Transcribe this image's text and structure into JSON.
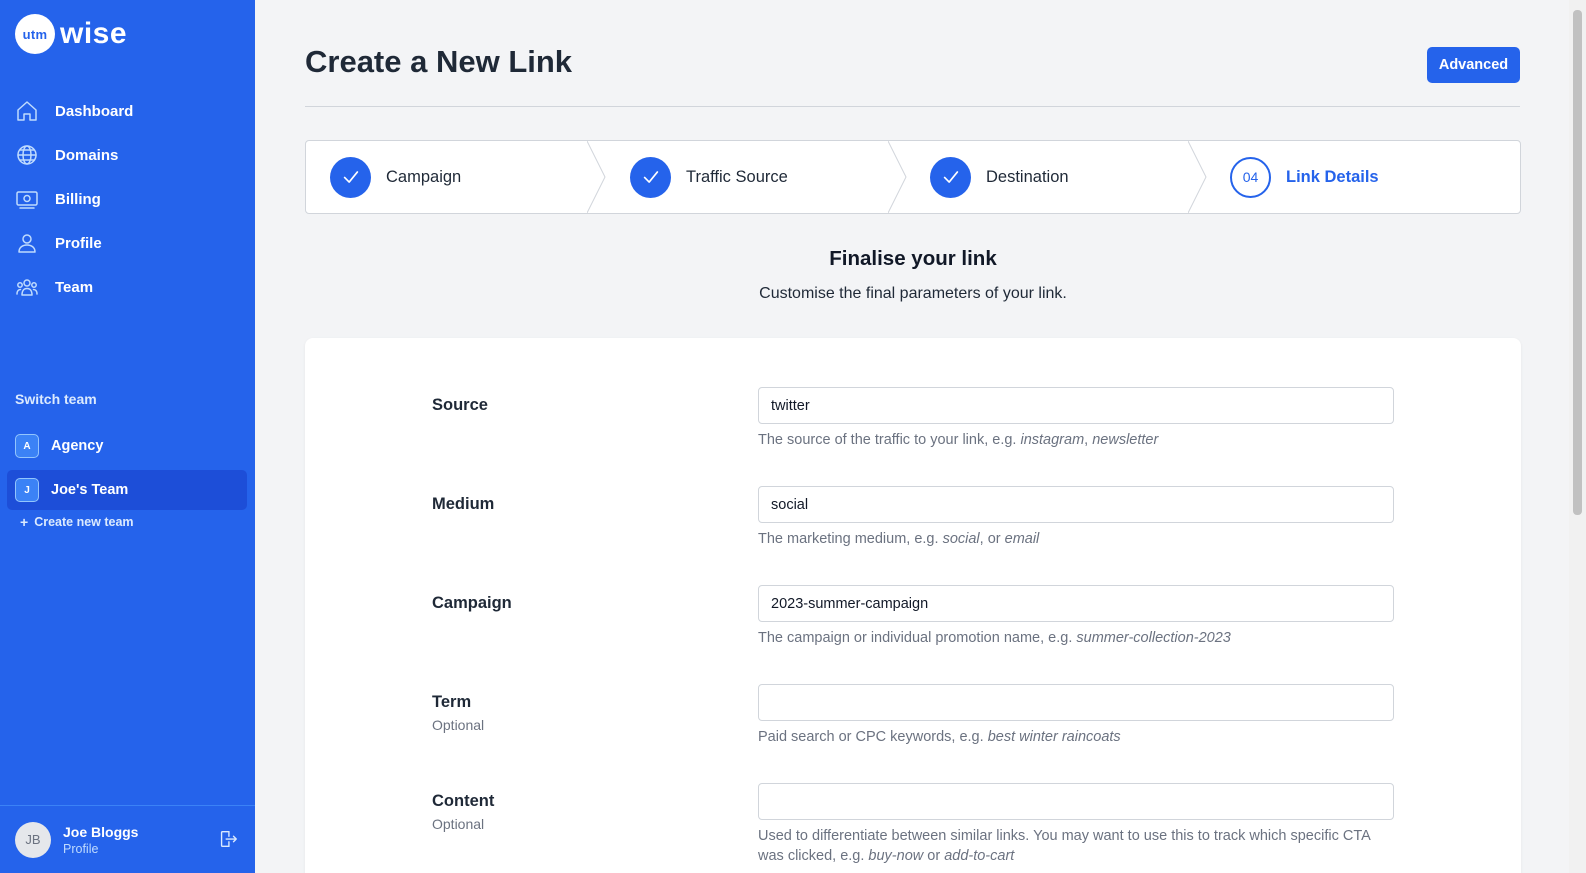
{
  "app": {
    "logo_badge": "utm",
    "logo_word": "wise"
  },
  "sidebar": {
    "items": [
      {
        "label": "Dashboard",
        "icon": "home-icon"
      },
      {
        "label": "Domains",
        "icon": "globe-icon"
      },
      {
        "label": "Billing",
        "icon": "billing-icon"
      },
      {
        "label": "Profile",
        "icon": "user-icon"
      },
      {
        "label": "Team",
        "icon": "team-icon"
      }
    ],
    "switch_team_title": "Switch team",
    "teams": [
      {
        "badge": "A",
        "name": "Agency",
        "active": false
      },
      {
        "badge": "J",
        "name": "Joe's Team",
        "active": true
      }
    ],
    "create_team_plus": "+",
    "create_team_label": "Create new team",
    "user": {
      "initials": "JB",
      "name": "Joe Bloggs",
      "sub": "Profile"
    }
  },
  "header": {
    "title": "Create a New Link",
    "advanced_label": "Advanced"
  },
  "stepper": {
    "steps": [
      {
        "label": "Campaign",
        "state": "done"
      },
      {
        "label": "Traffic Source",
        "state": "done"
      },
      {
        "label": "Destination",
        "state": "done"
      },
      {
        "label": "Link Details",
        "state": "current",
        "number": "04"
      }
    ]
  },
  "intro": {
    "title": "Finalise your link",
    "subtitle": "Customise the final parameters of your link."
  },
  "form": {
    "fields": [
      {
        "label": "Source",
        "optional": "",
        "value": "twitter",
        "help_prefix": "The source of the traffic to your link, e.g. ",
        "help_em1": "instagram",
        "help_mid": ", ",
        "help_em2": "newsletter",
        "help_suffix": ""
      },
      {
        "label": "Medium",
        "optional": "",
        "value": "social",
        "help_prefix": "The marketing medium, e.g. ",
        "help_em1": "social",
        "help_mid": ", or ",
        "help_em2": "email",
        "help_suffix": ""
      },
      {
        "label": "Campaign",
        "optional": "",
        "value": "2023-summer-campaign",
        "help_prefix": "The campaign or individual promotion name, e.g. ",
        "help_em1": "summer-collection-2023",
        "help_mid": "",
        "help_em2": "",
        "help_suffix": ""
      },
      {
        "label": "Term",
        "optional": "Optional",
        "value": "",
        "help_prefix": "Paid search or CPC keywords, e.g. ",
        "help_em1": "best winter raincoats",
        "help_mid": "",
        "help_em2": "",
        "help_suffix": ""
      },
      {
        "label": "Content",
        "optional": "Optional",
        "value": "",
        "help_prefix": "Used to differentiate between similar links. You may want to use this to track which specific CTA was clicked, e.g. ",
        "help_em1": "buy-now",
        "help_mid": " or ",
        "help_em2": "add-to-cart",
        "help_suffix": ""
      }
    ]
  },
  "colors": {
    "brand": "#2563eb",
    "brand_dark": "#1d4ed8",
    "background": "#f3f4f6"
  }
}
